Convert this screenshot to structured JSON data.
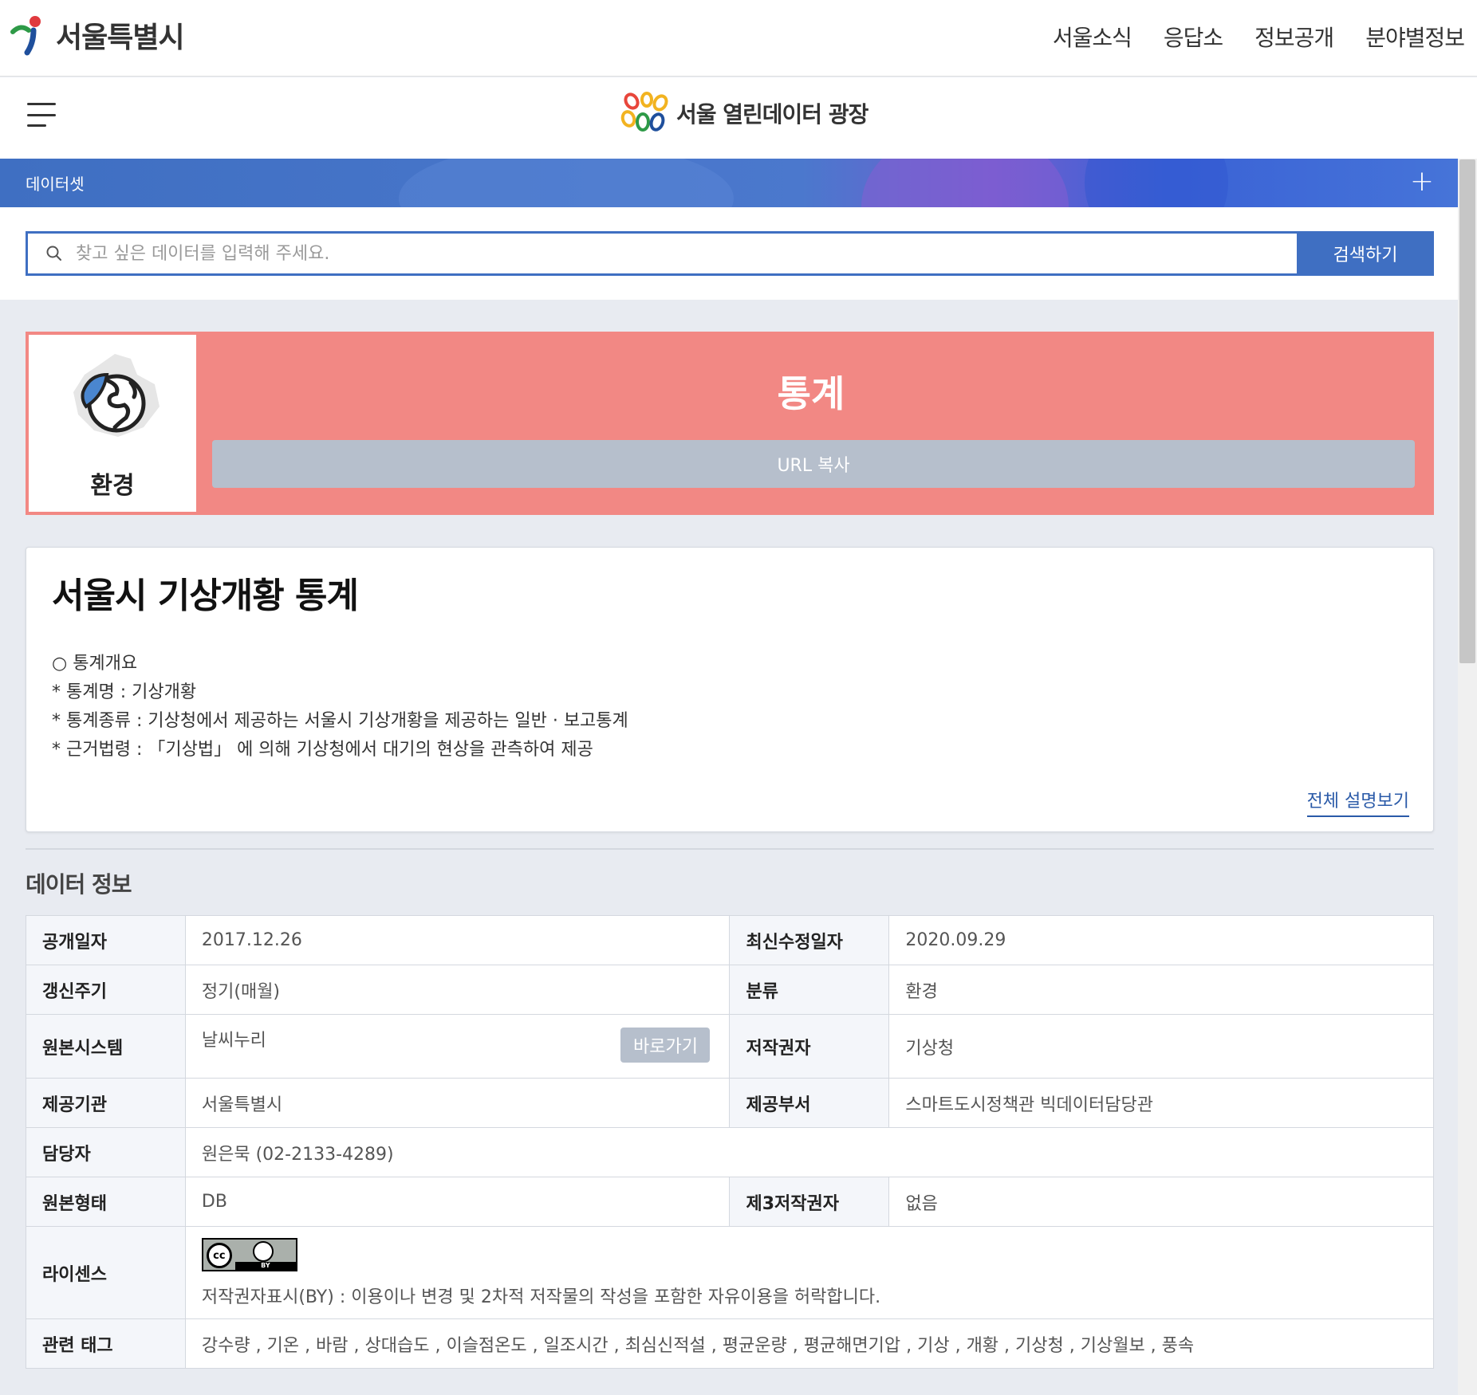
{
  "top_header": {
    "logo_text": "서울특별시",
    "nav": [
      "서울소식",
      "응답소",
      "정보공개",
      "분야별정보"
    ]
  },
  "sub_header": {
    "portal_title": "서울 열린데이터 광장"
  },
  "band": {
    "label": "데이터셋",
    "plus": "+"
  },
  "search": {
    "placeholder": "찾고 싶은 데이터를 입력해 주세요.",
    "button": "검색하기"
  },
  "category": {
    "card_label": "환경",
    "title": "통계",
    "url_button": "URL 복사"
  },
  "description": {
    "title": "서울시 기상개황 통계",
    "lines": [
      "○ 통계개요",
      "* 통계명 : 기상개황",
      "* 통계종류 : 기상청에서 제공하는 서울시 기상개황을 제공하는 일반 · 보고통계",
      "* 근거법령 : 「기상법」 에 의해 기상청에서 대기의 현상을 관측하여 제공"
    ],
    "more_link": "전체 설명보기"
  },
  "data_info": {
    "section_title": "데이터 정보",
    "rows": {
      "publish_date_label": "공개일자",
      "publish_date": "2017.12.26",
      "modified_label": "최신수정일자",
      "modified": "2020.09.29",
      "cycle_label": "갱신주기",
      "cycle": "정기(매월)",
      "category_label": "분류",
      "category": "환경",
      "source_label": "원본시스템",
      "source": "날씨누리",
      "go_button": "바로가기",
      "copyright_label": "저작권자",
      "copyright": "기상청",
      "provider_label": "제공기관",
      "provider": "서울특별시",
      "dept_label": "제공부서",
      "dept": "스마트도시정책관 빅데이터담당관",
      "manager_label": "담당자",
      "manager": "원은묵 (02-2133-4289)",
      "format_label": "원본형태",
      "format": "DB",
      "third_label": "제3저작권자",
      "third": "없음",
      "license_label": "라이센스",
      "license_badge": "cc-by-icon",
      "license_text": "저작권자표시(BY) : 이용이나 변경 및 2차적 저작물의 작성을 포함한 자유이용을 허락합니다.",
      "tags_label": "관련 태그",
      "tags": "강수량 , 기온 , 바람 , 상대습도 , 이슬점온도 , 일조시간 , 최심신적설 , 평균운량 , 평균해면기압 , 기상 , 개황 , 기상청 , 기상월보 , 풍속"
    }
  },
  "colors": {
    "accent_blue": "#3f6fc2",
    "category_red": "#f28884",
    "disabled_button": "#b6bfcc",
    "link_blue": "#2a5aa8"
  }
}
